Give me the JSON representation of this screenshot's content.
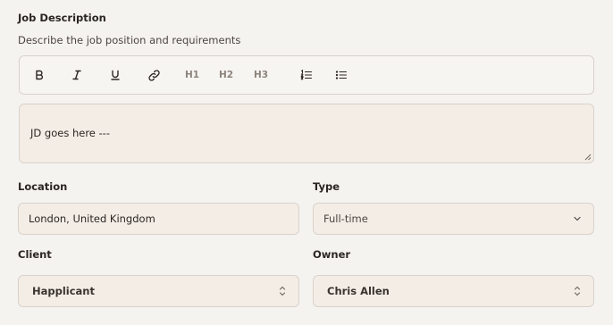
{
  "job_description": {
    "title": "Job Description",
    "subtitle": "Describe the job position and requirements",
    "toolbar": {
      "bold_icon": "bold-icon",
      "italic_icon": "italic-icon",
      "underline_icon": "underline-icon",
      "link_icon": "link-icon",
      "h1": "H1",
      "h2": "H2",
      "h3": "H3",
      "ordered_list_icon": "ordered-list-icon",
      "bullet_list_icon": "bullet-list-icon"
    },
    "editor_text": "JD goes here ---"
  },
  "location": {
    "label": "Location",
    "value": "London, United Kingdom"
  },
  "type": {
    "label": "Type",
    "value": "Full-time"
  },
  "client": {
    "label": "Client",
    "value": "Happlicant"
  },
  "owner": {
    "label": "Owner",
    "value": "Chris Allen"
  }
}
